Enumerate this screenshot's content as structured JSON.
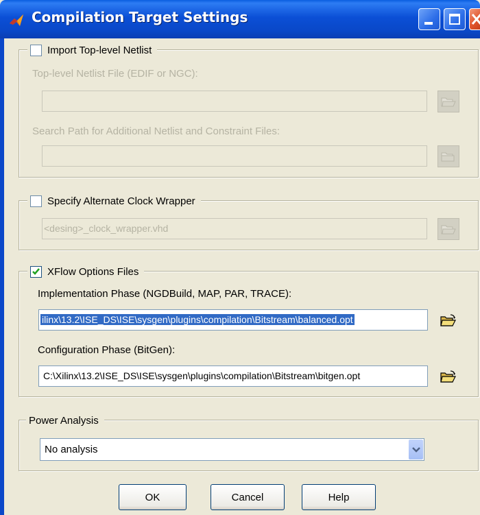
{
  "window": {
    "title": "Compilation Target Settings"
  },
  "import_netlist": {
    "checkbox_label": "Import Top-level Netlist",
    "checked": false,
    "netlist_file_label": "Top-level Netlist File (EDIF or NGC):",
    "netlist_file_value": "",
    "search_path_label": "Search Path for Additional Netlist and Constraint Files:",
    "search_path_value": ""
  },
  "clock_wrapper": {
    "checkbox_label": "Specify Alternate Clock Wrapper",
    "checked": false,
    "value": "<desing>_clock_wrapper.vhd"
  },
  "xflow": {
    "checkbox_label": "XFlow Options Files",
    "checked": true,
    "impl_label": "Implementation Phase (NGDBuild, MAP, PAR, TRACE):",
    "impl_value": "ilinx\\13.2\\ISE_DS\\ISE\\sysgen\\plugins\\compilation\\Bitstream\\balanced.opt",
    "config_label": "Configuration Phase (BitGen):",
    "config_value": "C:\\Xilinx\\13.2\\ISE_DS\\ISE\\sysgen\\plugins\\compilation\\Bitstream\\bitgen.opt"
  },
  "power": {
    "legend": "Power Analysis",
    "selected": "No analysis"
  },
  "buttons": {
    "ok": "OK",
    "cancel": "Cancel",
    "help": "Help"
  },
  "colors": {
    "titlebar": "#0a48c8",
    "selection": "#316ac5",
    "face": "#ece9d8"
  },
  "icons": {
    "app": "matlab-icon",
    "browse": "open-folder-icon",
    "minimize": "minimize-icon",
    "maximize": "maximize-icon",
    "close": "close-icon"
  }
}
